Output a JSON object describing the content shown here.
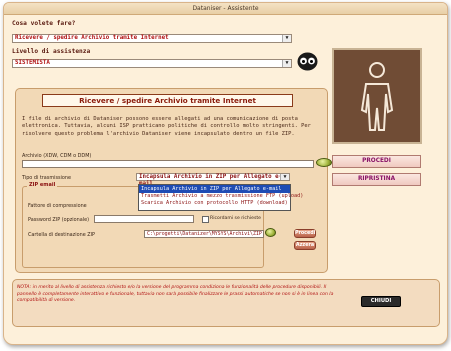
{
  "window": {
    "title": "Dataniser - Assistente"
  },
  "cosa_label": "Cosa volete fare?",
  "cosa_value": "Ricevere / spedire Archivio tramite Internet",
  "livello_label": "Livello di assistenza",
  "livello_value": "SISTEMISTA",
  "panel": {
    "banner": "Ricevere / spedire Archivio tramite  Internet",
    "description": "I file di archivio di Dataniser possono essere allegati ad una comunicazione di posta elettronica. Tuttavia, alcuni ISP pratticano politiche di controllo molto stringenti. Per risolvere questo problema l'archivio Dataniser viene incapsulato dentro un file ZIP.",
    "archivio_label": "Archivio (XDW, CDM o DDM)",
    "tipo_label": "Tipo di trasmissione",
    "tipo_value": "Incapsula Archivio in ZIP per Allegato e-mail",
    "zip_email_label": "ZIP email",
    "fattore_label": "Fattore di compressione",
    "password_label": "Password ZIP (opzionale)",
    "ricordami_label": "Ricordami se richieste",
    "cartella_label": "Cartella di destinazione ZIP",
    "cartella_value": "C:\\progetti\\Datanizer\\MYSYS\\Archivi\\ZIP",
    "procedi_small": "Procedi",
    "azzera_small": "Azzera"
  },
  "dropdown_options": [
    "Incapsula Archivio in ZIP per Allegato e-mail",
    "Trasmetti Archivio a mezzo trasmissione FTP (upload)",
    "Scarica Archivio con protocollo HTTP (download)"
  ],
  "dropdown_selected_index": 0,
  "buttons": {
    "procedi": "PROCEDI",
    "ripristina": "RIPRISTINA",
    "chiudi": "CHIUDI"
  },
  "note": "NOTA: in merito al livello di assistenza richiesto e/o la versione del programma condiziona le funzionalità delle procedure disponibili. Il pannello è completamente interattivo e funzionale, tuttavia non sarà possibile finalizzare le prassi automatiche se non si è in linea con la compatibilità di versione.",
  "colors": {
    "accent": "#8a1a0a",
    "selection": "#1f4cb4",
    "procedi": "#8a1468"
  }
}
